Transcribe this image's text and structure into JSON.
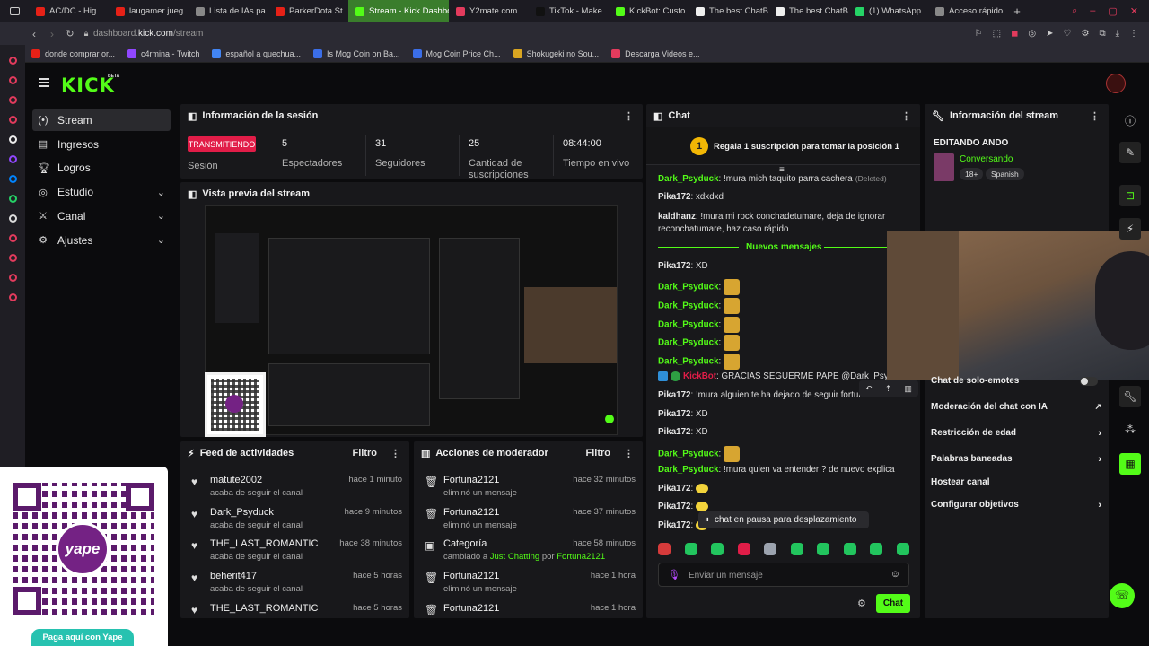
{
  "browser": {
    "tabs": [
      {
        "label": "AC/DC - Hig",
        "color": "#e62117"
      },
      {
        "label": "laugamer jueg",
        "color": "#e62117"
      },
      {
        "label": "Lista de IAs pa",
        "color": "#888888"
      },
      {
        "label": "ParkerDota St",
        "color": "#e62117"
      },
      {
        "label": "Stream - Kick Dashboard",
        "color": "#53fc18",
        "active": true
      },
      {
        "label": "Y2mate.com",
        "color": "#e33b5d"
      },
      {
        "label": "TikTok - Make",
        "color": "#111111"
      },
      {
        "label": "KickBot: Custo",
        "color": "#53fc18"
      },
      {
        "label": "The best ChatB",
        "color": "#eeeeee"
      },
      {
        "label": "The best ChatB",
        "color": "#eeeeee"
      },
      {
        "label": "(1) WhatsApp",
        "color": "#25d366"
      },
      {
        "label": "Acceso rápido",
        "color": "#888888"
      }
    ],
    "url_domain": "dashboard.",
    "url_host": "kick.com",
    "url_path": "/stream",
    "bookmarks": [
      "donde comprar or...",
      "c4rmina - Twitch",
      "español a quechua...",
      "Is Mog Coin on Ba...",
      "Mog Coin Price Ch...",
      "Shokugeki no Sou...",
      "Descarga Videos e..."
    ]
  },
  "kick": {
    "logo": "KICK",
    "beta": "BETA"
  },
  "nav": [
    {
      "label": "Stream",
      "icon": "stream-icon"
    },
    {
      "label": "Ingresos",
      "icon": "income-icon"
    },
    {
      "label": "Logros",
      "icon": "trophy-icon"
    },
    {
      "label": "Estudio",
      "icon": "studio-icon"
    },
    {
      "label": "Canal",
      "icon": "channel-icon"
    },
    {
      "label": "Ajustes",
      "icon": "settings-icon"
    }
  ],
  "session": {
    "title": "Información de la sesión",
    "status": "TRANSMITIENDO",
    "status_label": "Sesión",
    "stats": [
      {
        "value": "5",
        "label": "Espectadores"
      },
      {
        "value": "31",
        "label": "Seguidores"
      },
      {
        "value": "25",
        "label": "Cantidad de suscripciones"
      },
      {
        "value": "08:44:00",
        "label": "Tiempo en vivo"
      }
    ]
  },
  "preview": {
    "title": "Vista previa del stream"
  },
  "activity": {
    "title": "Feed de actividades",
    "filter": "Filtro",
    "items": [
      {
        "user": "matute2002",
        "action": "acaba de seguir el canal",
        "time": "hace 1 minuto"
      },
      {
        "user": "Dark_Psyduck",
        "action": "acaba de seguir el canal",
        "time": "hace 9 minutos"
      },
      {
        "user": "THE_LAST_ROMANTIC",
        "action": "acaba de seguir el canal",
        "time": "hace 38 minutos"
      },
      {
        "user": "beherit417",
        "action": "acaba de seguir el canal",
        "time": "hace 5 horas"
      },
      {
        "user": "THE_LAST_ROMANTIC",
        "action": "",
        "time": "hace 5 horas"
      }
    ]
  },
  "moderator": {
    "title": "Acciones de moderador",
    "filter": "Filtro",
    "items": [
      {
        "user": "Fortuna2121",
        "action": "eliminó un mensaje",
        "time": "hace 32 minutos"
      },
      {
        "user": "Fortuna2121",
        "action": "eliminó un mensaje",
        "time": "hace 37 minutos"
      },
      {
        "user": "Categoría",
        "action_pre": "cambiado a ",
        "action_cat": "Just Chatting",
        "action_mid": " por ",
        "action_by": "Fortuna2121",
        "time": "hace 58 minutos"
      },
      {
        "user": "Fortuna2121",
        "action": "eliminó un mensaje",
        "time": "hace 1 hora"
      },
      {
        "user": "Fortuna2121",
        "action": "",
        "time": "hace 1 hora"
      }
    ]
  },
  "chat": {
    "title": "Chat",
    "sub_rank": "1",
    "sub_banner": "Regala 1 suscripción para tomar la posición 1",
    "new_messages": "Nuevos mensajes",
    "paused": "chat en pausa para desplazamiento",
    "input_placeholder": "Enviar un mensaje",
    "send": "Chat",
    "messages": [
      {
        "user": "Dark_Psyduck",
        "text": "!mura mich taquito parra cachera",
        "note": "(Deleted)",
        "green": true
      },
      {
        "user": "Pika172",
        "text": "xdxdxd"
      },
      {
        "user": "kaldhanz",
        "text": "!mura mi rock conchadetumare, deja de ignorar",
        "text2": "reconchatumare, haz caso rápido"
      },
      {
        "user": "Pika172",
        "text": "XD"
      },
      {
        "user": "Dark_Psyduck",
        "emote": true,
        "green": true
      },
      {
        "user": "Dark_Psyduck",
        "emote": true,
        "green": true
      },
      {
        "user": "Dark_Psyduck",
        "emote": true,
        "green": true
      },
      {
        "user": "Dark_Psyduck",
        "emote": true,
        "green": true
      },
      {
        "user": "Dark_Psyduck",
        "emote": true,
        "green": true
      },
      {
        "user": "KickBot",
        "text": "GRACIAS SEGUERME PAPE @Dark_Psyduck",
        "bot": true
      },
      {
        "user": "Pika172",
        "text": "!mura alguien te ha dejado de seguir fortuna"
      },
      {
        "user": "Pika172",
        "text": "XD"
      },
      {
        "user": "Pika172",
        "text": "XD"
      },
      {
        "user": "Dark_Psyduck",
        "emote": true,
        "green": true
      },
      {
        "user": "Dark_Psyduck",
        "text": "!mura quien va entender ? de nuevo explica",
        "green": true
      },
      {
        "user": "Pika172",
        "emote2": true
      },
      {
        "user": "Pika172",
        "emote2": true
      },
      {
        "user": "Pika172",
        "emote2": true
      }
    ]
  },
  "stream_info": {
    "title": "Información del stream",
    "stream_title": "EDITANDO ANDO",
    "category": "Conversando",
    "tags": [
      "18+",
      "Spanish"
    ],
    "settings": [
      {
        "label": "Chat de solo-emotes",
        "type": "toggle"
      },
      {
        "label": "Moderación del chat con IA",
        "type": "external"
      },
      {
        "label": "Restricción de edad",
        "type": "arrow"
      },
      {
        "label": "Palabras baneadas",
        "type": "arrow"
      },
      {
        "label": "Hostear canal",
        "type": "none"
      },
      {
        "label": "Configurar objetivos",
        "type": "arrow"
      }
    ]
  },
  "qr": {
    "caption": "Paga aquí con Yape",
    "brand": "yape"
  },
  "colors": {
    "kick_green": "#53fc18",
    "live_red": "#e11d48",
    "panel": "#18181b",
    "yape_purple": "#742284"
  }
}
